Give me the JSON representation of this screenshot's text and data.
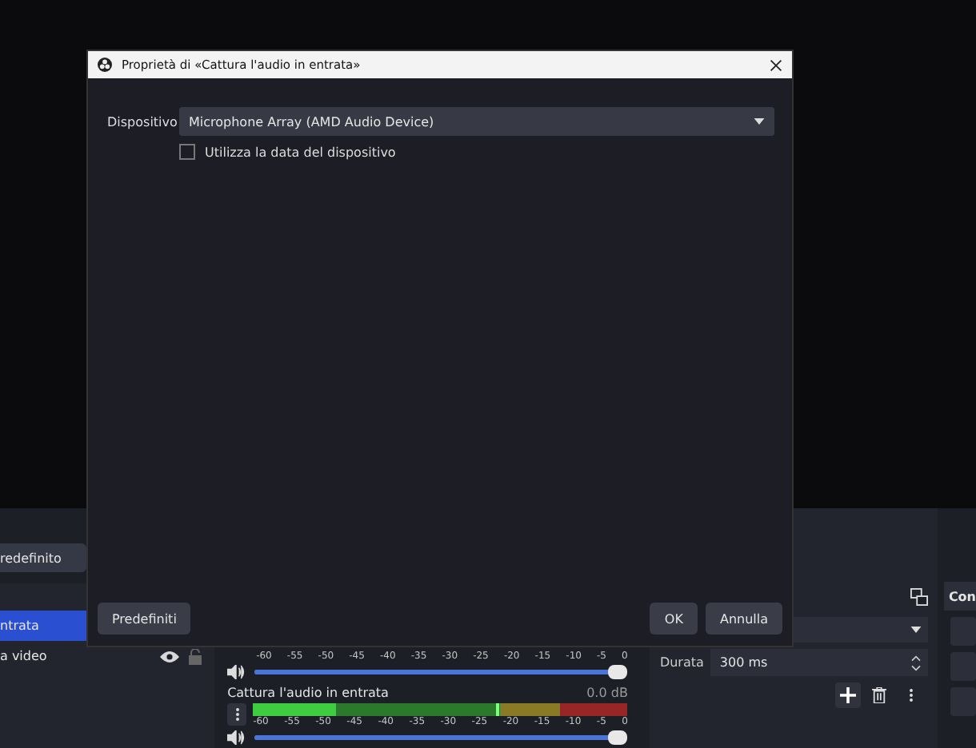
{
  "dialog": {
    "title": "Proprietà di «Cattura l'audio in entrata»",
    "device_label": "Dispositivo",
    "device_value": "Microphone Array (AMD Audio Device)",
    "use_device_timestamp": {
      "label": "Utilizza la data del dispositivo",
      "checked": false
    },
    "buttons": [
      {
        "kind": "defaults",
        "label": "Predefiniti"
      },
      {
        "kind": "ok",
        "label": "OK"
      },
      {
        "kind": "cancel",
        "label": "Annulla"
      }
    ]
  },
  "scenes": {
    "button": "redefinito",
    "items": [
      {
        "label": "ntrata",
        "selected": true
      },
      {
        "label": "a video",
        "selected": false
      }
    ]
  },
  "mixer": {
    "top_ticks": [
      "-60",
      "-55",
      "-50",
      "-45",
      "-40",
      "-35",
      "-30",
      "-25",
      "-20",
      "-15",
      "-10",
      "-5",
      "0"
    ],
    "top_volume": {
      "level": 1
    },
    "channel": {
      "name": "Cattura l'audio in entrata",
      "reading": "0.0 dB",
      "level": 0.22,
      "ticks": [
        "-60",
        "-55",
        "-50",
        "-45",
        "-40",
        "-35",
        "-30",
        "-25",
        "-20",
        "-15",
        "-10",
        "-5",
        "0"
      ],
      "volume": {
        "level": 1
      }
    }
  },
  "transitions": {
    "duration_label": "Durata",
    "duration_value": "300 ms"
  },
  "controls": {
    "title": "Con"
  }
}
